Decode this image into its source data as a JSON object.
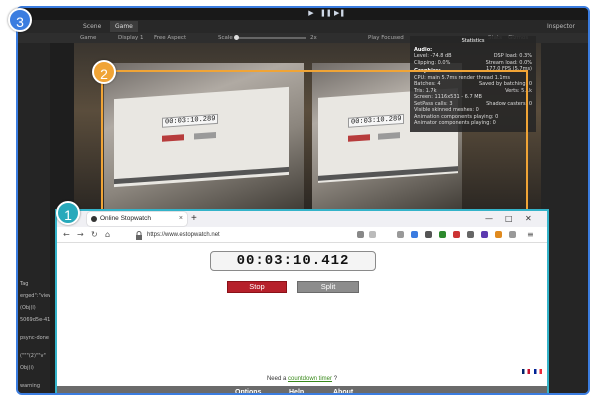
{
  "badges": {
    "one": "1",
    "two": "2",
    "three": "3"
  },
  "unity": {
    "play": "▶",
    "pause": "❚❚",
    "step": "▶❚",
    "tabs": {
      "scene": "Scene",
      "game": "Game",
      "inspector": "Inspector"
    },
    "gamebar": {
      "mode": "Game",
      "display": "Display 1",
      "aspect": "Free Aspect",
      "scale_label": "Scale",
      "scale_value": "2x",
      "play_focused": "Play Focused",
      "stats": "Stats",
      "gizmos": "Gizmos"
    },
    "left_list": [
      "Tag",
      "erged\":\"view\"",
      "(Obj(l)",
      "5069d5e-4116",
      "",
      "psync-done",
      "",
      "(\"\"\"(2)\"\"v\"",
      "Obj(i)",
      "",
      "warning"
    ],
    "stats": {
      "title": "Statistics",
      "audio_header": "Audio:",
      "level": "Level: -74.8 dB",
      "dsp_load": "DSP load: 0.3%",
      "clipping": "Clipping: 0.0%",
      "stream_load": "Stream load: 0.0%",
      "graphics_header": "Graphics:",
      "fps": "177.0 FPS (5.7ms)",
      "cpu": "CPU: main 5.7ms  render thread 1.1ms",
      "batches": "Batches: 4",
      "saved_batching": "Saved by batching: 0",
      "tris": "Tris: 1.7k",
      "verts": "Verts: 5.1k",
      "screen": "Screen: 1116x531 - 6.7 MB",
      "setpass": "SetPass calls: 3",
      "shadow_casters": "Shadow casters: 0",
      "visible_skinned": "Visible skinned meshes: 0",
      "animation_components": "Animation components playing: 0",
      "animator_components": "Animator components playing: 0"
    },
    "camera_time": "00:03:10.289"
  },
  "browser": {
    "tab_title": "Online Stopwatch",
    "tab_close": "×",
    "new_tab": "+",
    "win_min": "—",
    "win_max": "□",
    "win_close": "✕",
    "back": "←",
    "forward": "→",
    "reload": "↻",
    "home": "⌂",
    "url": "https://www.estopwatch.net",
    "menu": "≡",
    "stopwatch_time": "00:03:10.412",
    "stop_label": "Stop",
    "split_label": "Split",
    "countdown_prefix": "Need a",
    "countdown_link": "countdown timer",
    "countdown_suffix": "?",
    "footer": {
      "options": "Options",
      "help": "Help",
      "about": "About"
    }
  },
  "colors": {
    "frame_blue": "#3b7de0",
    "box_orange": "#f0a436",
    "browser_teal": "#34b3c9",
    "stop_red": "#b6202a"
  }
}
